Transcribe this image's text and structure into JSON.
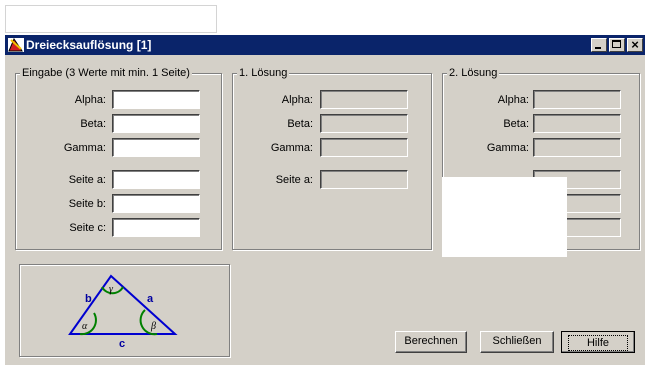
{
  "window": {
    "title": "Dreiecksauflösung [1]",
    "minimize": "_",
    "maximize": "□",
    "close": "×"
  },
  "input_group": {
    "legend": "Eingabe (3 Werte mit min. 1 Seite)",
    "labels": {
      "alpha": "Alpha:",
      "beta": "Beta:",
      "gamma": "Gamma:",
      "a": "Seite a:",
      "b": "Seite b:",
      "c": "Seite c:"
    },
    "values": {
      "alpha": "",
      "beta": "",
      "gamma": "",
      "a": "",
      "b": "",
      "c": ""
    }
  },
  "solution1": {
    "legend": "1. Lösung",
    "labels": {
      "alpha": "Alpha:",
      "beta": "Beta:",
      "gamma": "Gamma:",
      "a": "Seite a:"
    }
  },
  "solution2": {
    "legend": "2. Lösung",
    "labels": {
      "alpha": "Alpha:",
      "beta": "Beta:",
      "gamma": "Gamma:"
    }
  },
  "figure": {
    "b": "b",
    "a": "a",
    "c": "c",
    "alpha": "α",
    "beta": "β",
    "gamma": "γ"
  },
  "buttons": {
    "calc": "Berechnen",
    "close": "Schließen",
    "help": "Hilfe"
  }
}
